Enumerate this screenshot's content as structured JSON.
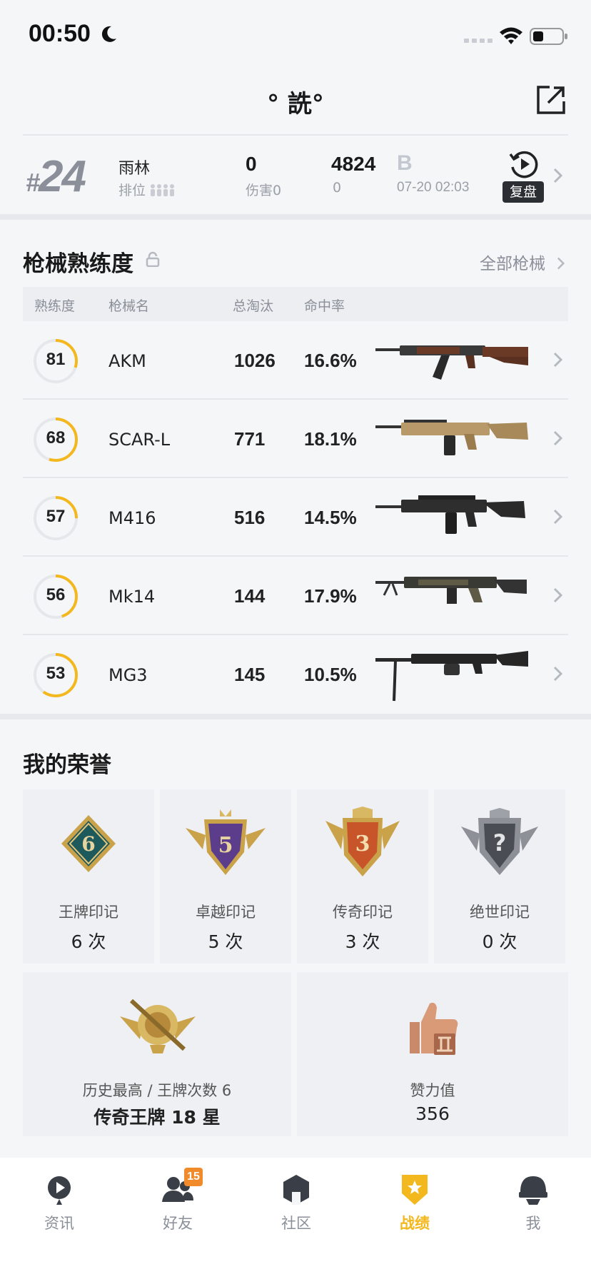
{
  "status_bar": {
    "time": "00:50"
  },
  "header": {
    "title": "°  詵°"
  },
  "recent_match": {
    "rank_hash": "#",
    "rank_number": "24",
    "map": "雨林",
    "rank_label": "排位",
    "kills": "0",
    "damage_label": "伤害0",
    "score": "4824",
    "score_sub": "0",
    "grade": "B",
    "time": "07-20 02:03",
    "replay_label": "复盘"
  },
  "weapons": {
    "title": "枪械熟练度",
    "all_link": "全部枪械",
    "columns": [
      "熟练度",
      "枪械名",
      "总淘汰",
      "命中率"
    ],
    "rows": [
      {
        "level": "81",
        "progress": 0.3,
        "name": "AKM",
        "kills": "1026",
        "accuracy": "16.6%"
      },
      {
        "level": "68",
        "progress": 0.55,
        "name": "SCAR-L",
        "kills": "771",
        "accuracy": "18.1%"
      },
      {
        "level": "57",
        "progress": 0.25,
        "name": "M416",
        "kills": "516",
        "accuracy": "14.5%"
      },
      {
        "level": "56",
        "progress": 0.45,
        "name": "Mk14",
        "kills": "144",
        "accuracy": "17.9%"
      },
      {
        "level": "53",
        "progress": 0.6,
        "name": "MG3",
        "kills": "145",
        "accuracy": "10.5%"
      }
    ]
  },
  "honors": {
    "title": "我的荣誉",
    "badges": [
      {
        "icon": "ace-badge-icon",
        "label": "王牌印记",
        "count": "6 次",
        "numeral": "6"
      },
      {
        "icon": "crown-badge-icon",
        "label": "卓越印记",
        "count": "5 次",
        "numeral": "5"
      },
      {
        "icon": "legend-badge-icon",
        "label": "传奇印记",
        "count": "3 次",
        "numeral": "3"
      },
      {
        "icon": "peerless-badge-icon",
        "label": "绝世印记",
        "count": "0 次",
        "numeral": "?"
      }
    ],
    "highest": {
      "label": "历史最高 / 王牌次数 6",
      "value": "传奇王牌 18 星"
    },
    "likes": {
      "label": "赞力值",
      "value": "356"
    }
  },
  "nav": {
    "items": [
      {
        "label": "资讯",
        "icon": "news-icon",
        "active": false
      },
      {
        "label": "好友",
        "icon": "friends-icon",
        "active": false,
        "badge": "15"
      },
      {
        "label": "社区",
        "icon": "community-icon",
        "active": false
      },
      {
        "label": "战绩",
        "icon": "record-icon",
        "active": true
      },
      {
        "label": "我",
        "icon": "profile-helmet-icon",
        "active": false
      }
    ]
  },
  "colors": {
    "accent": "#f4b81f",
    "ring_track": "#e6e7ea",
    "badge": "#f08a2a"
  }
}
